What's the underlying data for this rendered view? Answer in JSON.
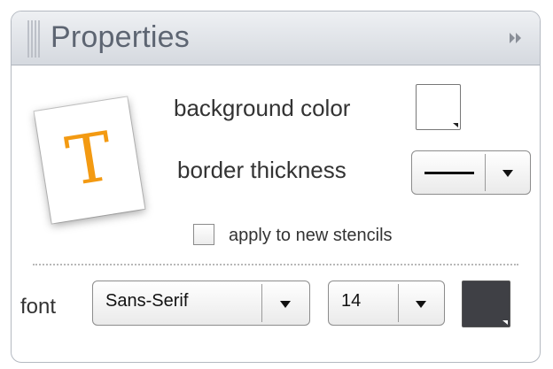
{
  "panel": {
    "title": "Properties",
    "collapse_icon": "double-chevron-right-icon",
    "text_tool_icon": "text-tool-icon",
    "text_tool_glyph": "T"
  },
  "fields": {
    "background_color_label": "background color",
    "background_color": "#ffffff",
    "border_thickness_label": "border thickness",
    "border_thickness_icon": "line-thickness-icon",
    "apply_label": "apply to new stencils",
    "apply_checked": false
  },
  "font": {
    "label": "font",
    "family_value": "Sans-Serif",
    "size_value": "14",
    "color": "#3f4045"
  }
}
